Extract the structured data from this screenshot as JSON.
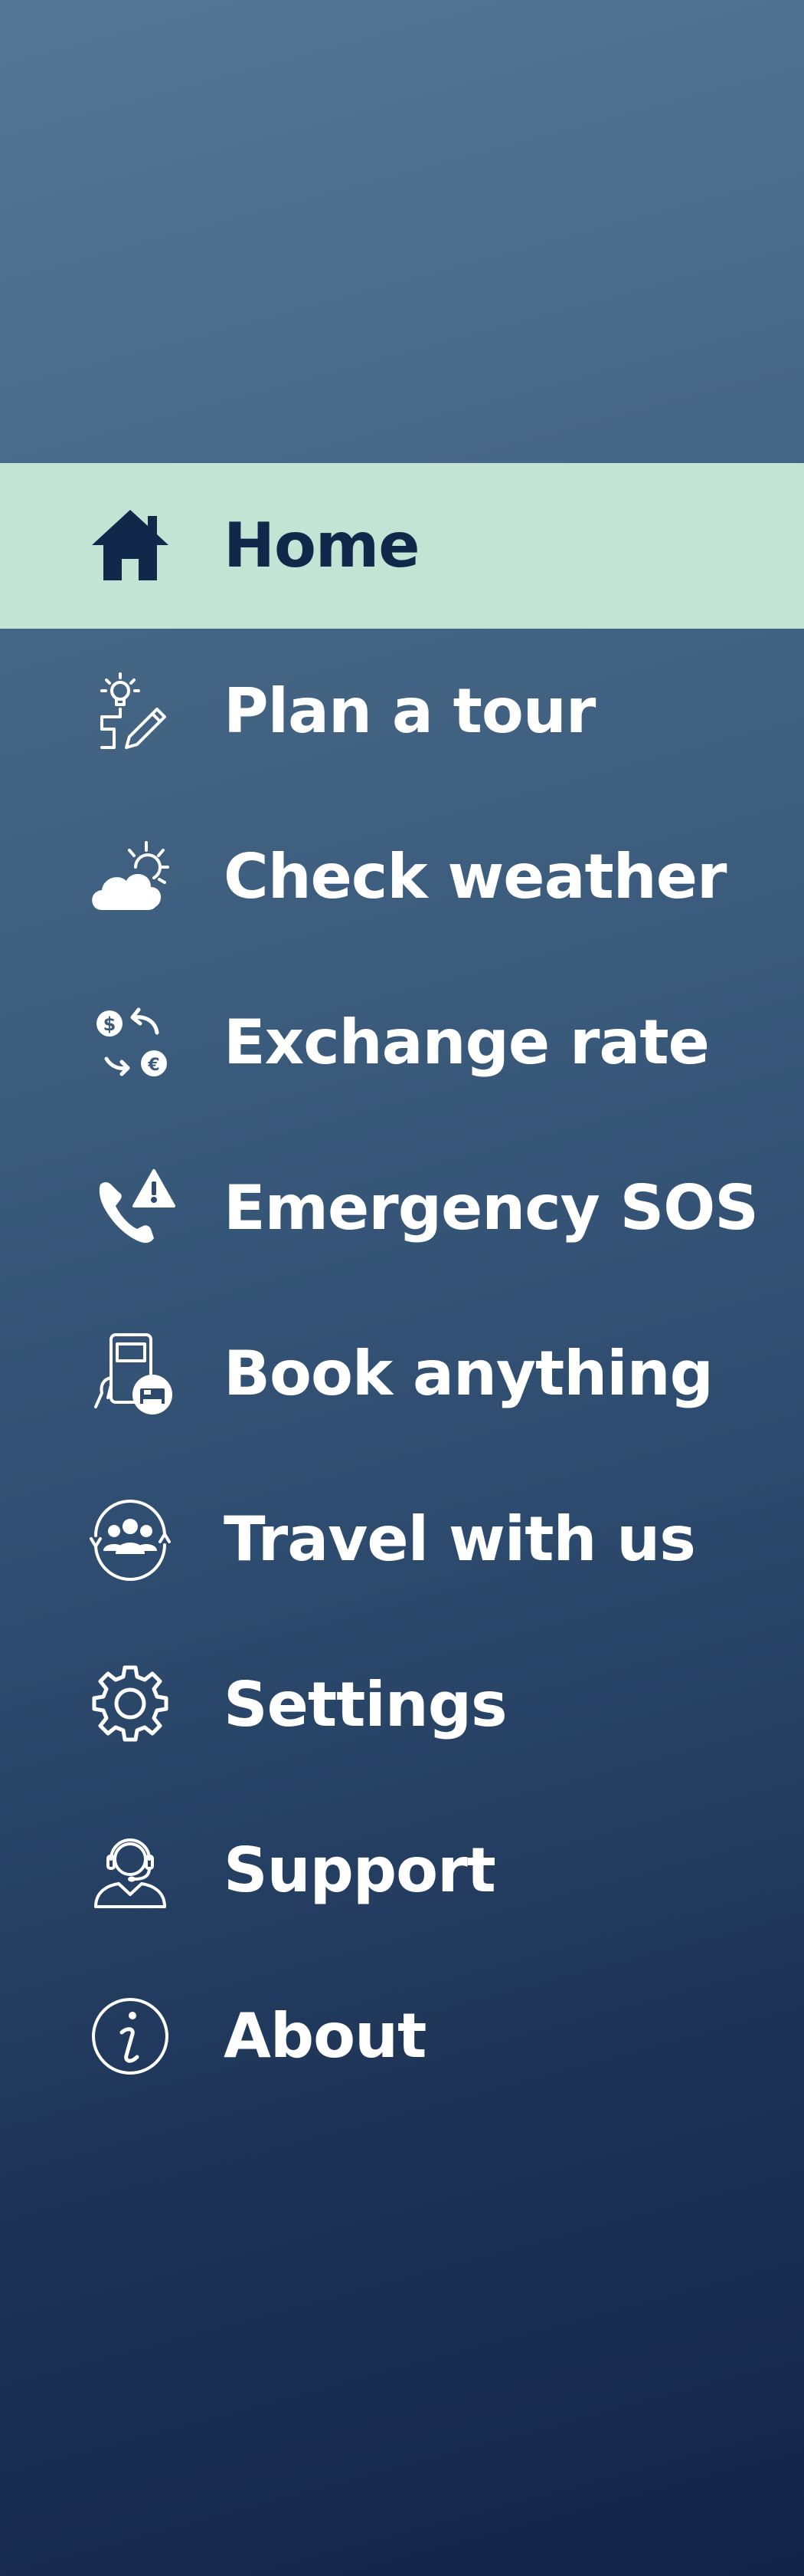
{
  "colors": {
    "active_background": "#c3e4d5",
    "active_text": "#11284a",
    "text": "#ffffff",
    "gradient_top": "#537795",
    "gradient_bottom": "#13234a"
  },
  "menu": {
    "items": [
      {
        "label": "Home",
        "icon": "home-icon",
        "active": true
      },
      {
        "label": "Plan a tour",
        "icon": "plan-tour-icon",
        "active": false
      },
      {
        "label": "Check weather",
        "icon": "weather-icon",
        "active": false
      },
      {
        "label": "Exchange rate",
        "icon": "exchange-rate-icon",
        "active": false
      },
      {
        "label": "Emergency SOS",
        "icon": "emergency-sos-icon",
        "active": false
      },
      {
        "label": "Book anything",
        "icon": "booking-icon",
        "active": false
      },
      {
        "label": "Travel with us",
        "icon": "travel-group-icon",
        "active": false
      },
      {
        "label": "Settings",
        "icon": "gear-icon",
        "active": false
      },
      {
        "label": "Support",
        "icon": "support-agent-icon",
        "active": false
      },
      {
        "label": "About",
        "icon": "info-icon",
        "active": false
      }
    ]
  }
}
